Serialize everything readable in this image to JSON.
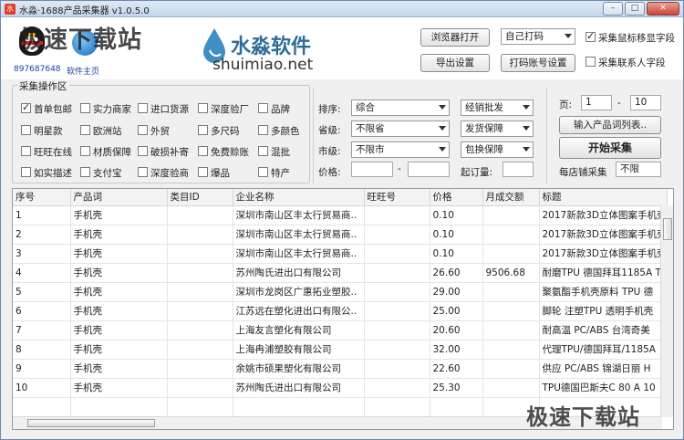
{
  "window": {
    "title": "水淼·1688产品采集器 v1.0.5.0",
    "buttons": {
      "minimize": "–",
      "maximize": "□",
      "close": "✕"
    }
  },
  "watermark": "极速下载站",
  "header": {
    "qq_number": "897687648",
    "home_label": "软件主页",
    "logo_cn": "水淼软件",
    "logo_en": "shuimiao.net"
  },
  "toolbar": {
    "browser_open": "浏览器打开",
    "export_settings": "导出设置",
    "captcha_select": "自己打码",
    "captcha_account": "打码账号设置",
    "opt_mouse_move": "采集鼠标移显字段",
    "opt_contact": "采集联系人字段"
  },
  "collect_area": {
    "title": "采集操作区",
    "items": [
      {
        "label": "首单包邮",
        "checked": true
      },
      {
        "label": "实力商家",
        "checked": false
      },
      {
        "label": "进口货源",
        "checked": false
      },
      {
        "label": "深度验厂",
        "checked": false
      },
      {
        "label": "品牌",
        "checked": false
      },
      {
        "label": "明星款",
        "checked": false
      },
      {
        "label": "欧洲站",
        "checked": false
      },
      {
        "label": "外贸",
        "checked": false
      },
      {
        "label": "多尺码",
        "checked": false
      },
      {
        "label": "多颜色",
        "checked": false
      },
      {
        "label": "旺旺在线",
        "checked": false
      },
      {
        "label": "材质保障",
        "checked": false
      },
      {
        "label": "破损补寄",
        "checked": false
      },
      {
        "label": "免费赊账",
        "checked": false
      },
      {
        "label": "混批",
        "checked": false
      },
      {
        "label": "如实描述",
        "checked": false
      },
      {
        "label": "支付宝",
        "checked": false
      },
      {
        "label": "深度验商",
        "checked": false
      },
      {
        "label": "爆品",
        "checked": false
      },
      {
        "label": "特产",
        "checked": false
      }
    ]
  },
  "filters": {
    "sort_label": "排序:",
    "sort_value": "综合",
    "province_label": "省级:",
    "province_value": "不限省",
    "city_label": "市级:",
    "city_value": "不限市",
    "price_label": "价格:",
    "price_dash": "-",
    "business_value": "经销批发",
    "shipping_value": "发货保障",
    "exchange_value": "包换保障",
    "min_order_label": "起订量:"
  },
  "controls": {
    "page_label": "页:",
    "page_from": "1",
    "page_dash": "-",
    "page_to": "10",
    "import_keywords": "输入产品词列表..",
    "start_collect": "开始采集",
    "per_shop_label": "每店铺采集",
    "per_shop_value": "不限"
  },
  "table": {
    "columns": [
      "序号",
      "产品词",
      "类目ID",
      "企业名称",
      "旺旺号",
      "价格",
      "月成交额",
      "标题"
    ],
    "rows": [
      [
        "1",
        "手机壳",
        "",
        "深圳市南山区丰太行贸易商..",
        "",
        "0.10",
        "",
        "2017新款3D立体图案手机壳"
      ],
      [
        "2",
        "手机壳",
        "",
        "深圳市南山区丰太行贸易商..",
        "",
        "0.10",
        "",
        "2017新款3D立体图案手机壳"
      ],
      [
        "3",
        "手机壳",
        "",
        "深圳市南山区丰太行贸易商..",
        "",
        "0.10",
        "",
        "2017新款3D立体图案手机壳"
      ],
      [
        "4",
        "手机壳",
        "",
        "苏州陶氏进出口有限公司",
        "",
        "26.60",
        "9506.68",
        "耐磨TPU 德国拜耳1185A T"
      ],
      [
        "5",
        "手机壳",
        "",
        "深圳市龙岗区广惠拓业塑胶..",
        "",
        "29.00",
        "",
        "聚氨酯手机壳原料 TPU 德"
      ],
      [
        "6",
        "手机壳",
        "",
        "江苏远在塑化进出口有限公..",
        "",
        "25.00",
        "",
        "脚轮 注塑TPU 透明手机壳"
      ],
      [
        "7",
        "手机壳",
        "",
        "上海友言塑化有限公司",
        "",
        "20.60",
        "",
        "耐高温 PC/ABS 台湾奇美"
      ],
      [
        "8",
        "手机壳",
        "",
        "上海冉浦塑胶有限公司",
        "",
        "32.00",
        "",
        "代理TPU/德国拜耳/1185A"
      ],
      [
        "9",
        "手机壳",
        "",
        "余姚市硕果塑化有限公司",
        "",
        "22.60",
        "",
        "供应 PC/ABS 锦湖日丽 H"
      ],
      [
        "10",
        "手机壳",
        "",
        "苏州陶氏进出口有限公司",
        "",
        "25.30",
        "",
        "TPU德国巴斯夫C 80 A 10"
      ]
    ]
  }
}
